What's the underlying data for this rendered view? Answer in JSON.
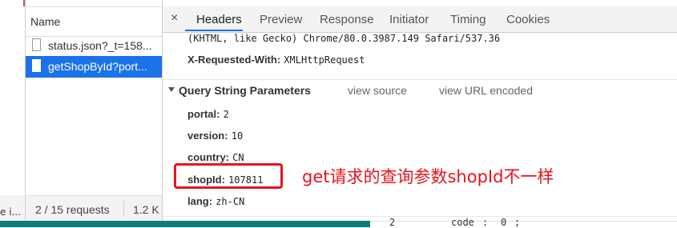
{
  "left_edge": {
    "cut_text": "e i..."
  },
  "bottom_code_fragments": [
    "2",
    "code",
    ":",
    "0",
    ";"
  ],
  "name_panel": {
    "header": "Name",
    "requests": [
      {
        "label": "status.json?_t=158...",
        "selected": false
      },
      {
        "label": "getShopById?port...",
        "selected": true
      }
    ],
    "footer": {
      "count": "2 / 15 requests",
      "size": "1.2 K"
    }
  },
  "details": {
    "close_glyph": "×",
    "tabs": [
      "Headers",
      "Preview",
      "Response",
      "Initiator",
      "Timing",
      "Cookies"
    ],
    "active_tab": "Headers",
    "ua_tail": "(KHTML, like Gecko) Chrome/80.0.3987.149 Safari/537.36",
    "x_requested_with": {
      "key": "X-Requested-With:",
      "value": "XMLHttpRequest"
    },
    "query_section": {
      "title": "Query String Parameters",
      "view_source": "view source",
      "view_url_encoded": "view URL encoded"
    },
    "params": [
      {
        "key": "portal:",
        "value": "2"
      },
      {
        "key": "version:",
        "value": "10"
      },
      {
        "key": "country:",
        "value": "CN"
      },
      {
        "key": "shopId:",
        "value": "107811"
      },
      {
        "key": "lang:",
        "value": "zh-CN"
      }
    ]
  },
  "annotation": {
    "text": "get请求的查询参数shopId不一样",
    "color": "#e8141c"
  },
  "colors": {
    "selected_row": "#1a73e8",
    "tab_underline": "#1a73e8",
    "bottom_bar": "#0f7c7a"
  }
}
